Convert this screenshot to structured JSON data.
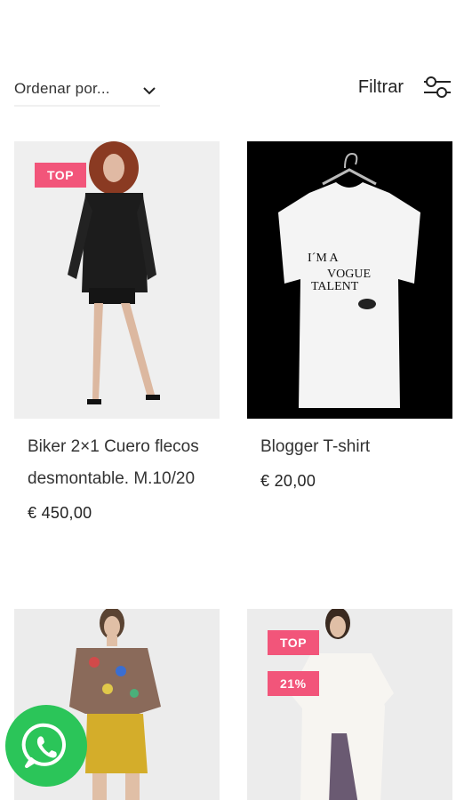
{
  "toolbar": {
    "sort_label": "Ordenar por...",
    "filter_label": "Filtrar",
    "sort_icon": "chevron-down-icon",
    "filter_icon": "sliders-icon"
  },
  "products": [
    {
      "title": "Biker 2×1 Cuero flecos desmontable. M.10/20",
      "price": "€ 450,00",
      "badges": [
        "TOP"
      ]
    },
    {
      "title": "Blogger T-shirt",
      "price": "€ 20,00",
      "badges": [],
      "print_text": [
        "I´M A",
        "VOGUE",
        "TALENT"
      ]
    },
    {
      "title": "",
      "price": "",
      "badges": []
    },
    {
      "title": "",
      "price": "",
      "badges": [
        "TOP",
        "21%"
      ]
    }
  ],
  "colors": {
    "badge": "#f2557a",
    "whatsapp": "#2bc559"
  },
  "floating": {
    "whatsapp_icon": "whatsapp-icon"
  }
}
